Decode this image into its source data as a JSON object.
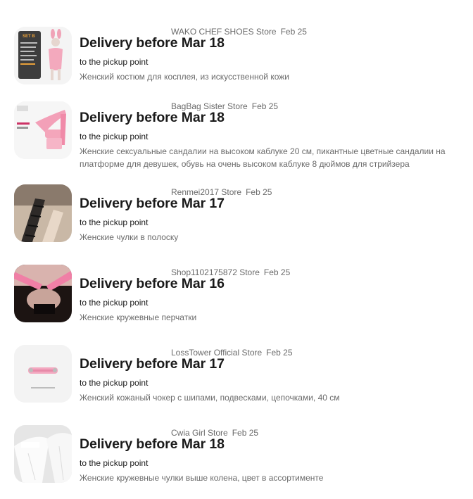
{
  "orders": [
    {
      "store": "WAKO CHEF SHOES Store",
      "date": "Feb 25",
      "delivery": "Delivery before Mar 18",
      "pickup": "to the pickup point",
      "description": "Женский костюм для косплея, из искусственной кожи",
      "thumb_text": "SET B"
    },
    {
      "store": "BagBag Sister Store",
      "date": "Feb 25",
      "delivery": "Delivery before Mar 18",
      "pickup": "to the pickup point",
      "description": "Женские сексуальные сандалии на высоком каблуке 20 см, пикантные цветные сандалии на платформе для девушек, обувь на очень высоком каблуке 8 дюймов для стрийзера"
    },
    {
      "store": "Renmei2017 Store",
      "date": "Feb 25",
      "delivery": "Delivery before Mar 17",
      "pickup": "to the pickup point",
      "description": "Женские чулки в полоску"
    },
    {
      "store": "Shop1102175872 Store",
      "date": "Feb 25",
      "delivery": "Delivery before Mar 16",
      "pickup": "to the pickup point",
      "description": "Женские кружевные перчатки"
    },
    {
      "store": "LossTower Official Store",
      "date": "Feb 25",
      "delivery": "Delivery before Mar 17",
      "pickup": "to the pickup point",
      "description": "Женский кожаный чокер с шипами, подвесками, цепочками, 40 см"
    },
    {
      "store": "Cwia Girl Store",
      "date": "Feb 25",
      "delivery": "Delivery before Mar 18",
      "pickup": "to the pickup point",
      "description": "Женские кружевные чулки выше колена, цвет в ассортименте"
    }
  ]
}
